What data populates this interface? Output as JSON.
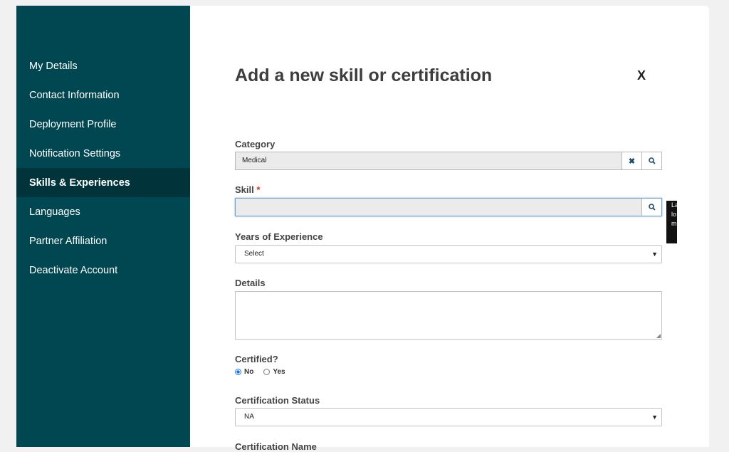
{
  "sidebar": {
    "items": [
      {
        "label": "My Details"
      },
      {
        "label": "Contact Information"
      },
      {
        "label": "Deployment Profile"
      },
      {
        "label": "Notification Settings"
      },
      {
        "label": "Skills & Experiences"
      },
      {
        "label": "Languages"
      },
      {
        "label": "Partner Affiliation"
      },
      {
        "label": "Deactivate Account"
      }
    ]
  },
  "modal": {
    "title": "Add a new skill or certification",
    "close_label": "X",
    "category": {
      "label": "Category",
      "value": "Medical"
    },
    "skill": {
      "label": "Skill",
      "required_marker": "*",
      "value": ""
    },
    "years": {
      "label": "Years of Experience",
      "value": "Select"
    },
    "details": {
      "label": "Details",
      "value": ""
    },
    "certified": {
      "label": "Certified?",
      "options": [
        "No",
        "Yes"
      ],
      "selected": "No"
    },
    "cert_status": {
      "label": "Certification Status",
      "value": "NA"
    },
    "cert_name": {
      "label": "Certification Name"
    }
  },
  "tooltip": {
    "text": "La lo m"
  },
  "colors": {
    "sidebar": "#004751",
    "sidebar_active": "#00333a",
    "required": "#c0392b",
    "focus": "#6fa3d6"
  },
  "icons": {
    "clear": "close-icon",
    "lookup": "search-icon",
    "dropdown": "chevron-down-icon"
  }
}
